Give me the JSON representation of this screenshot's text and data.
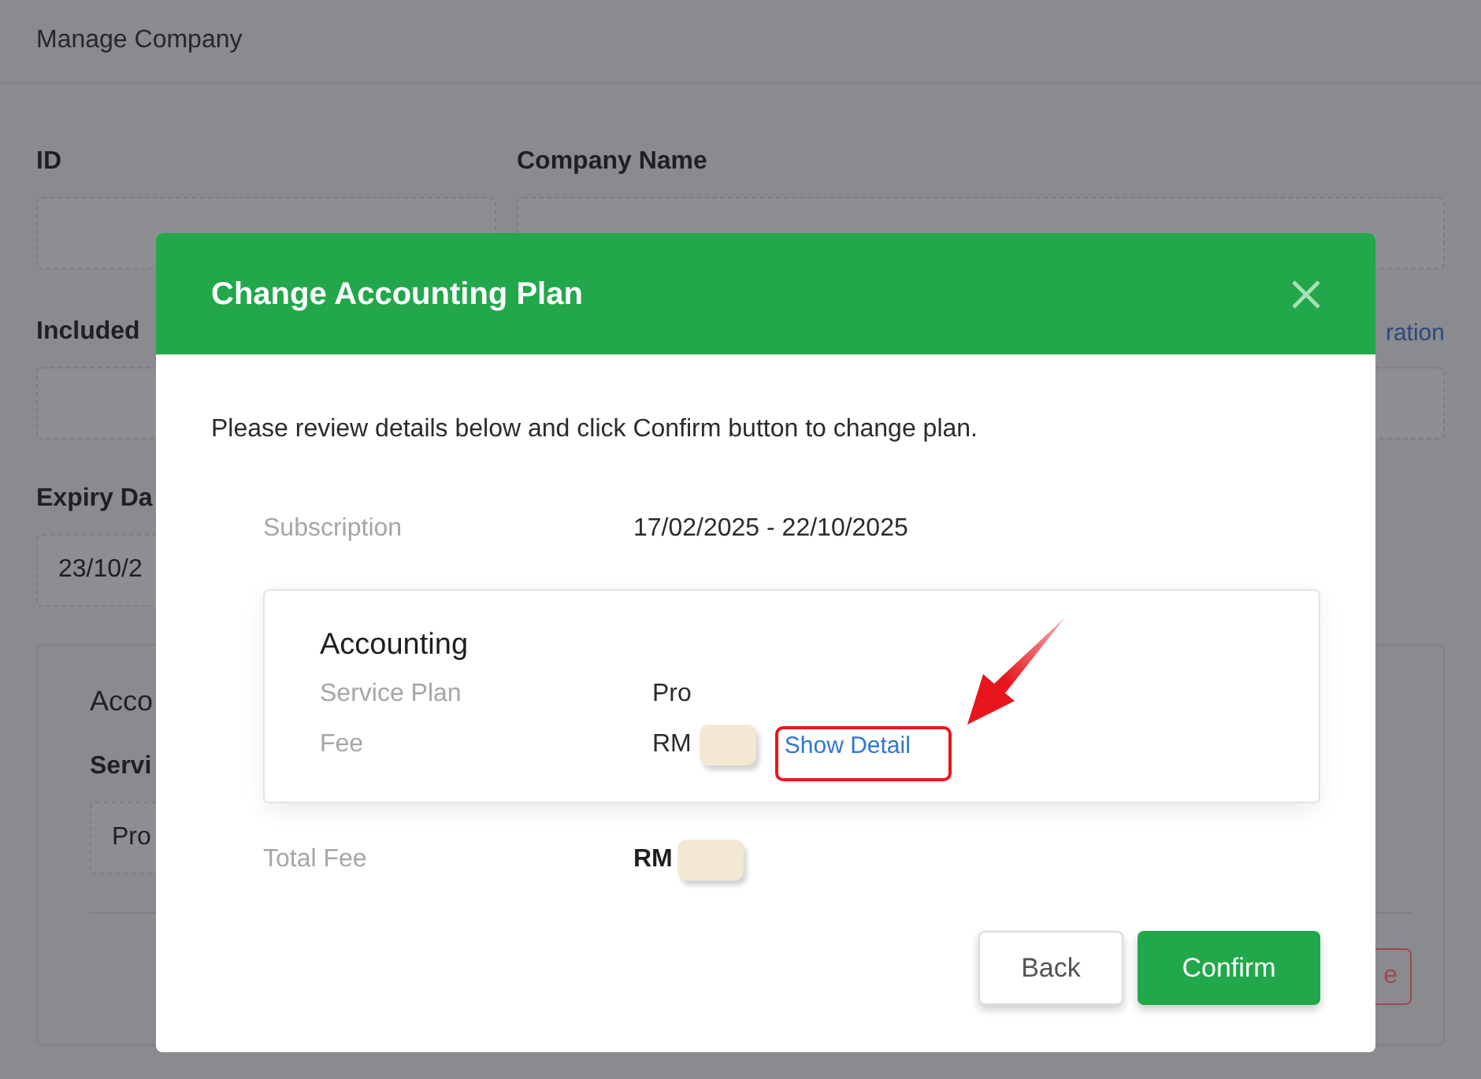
{
  "page": {
    "title": "Manage Company",
    "id_field": {
      "label": "ID"
    },
    "company_field": {
      "label": "Company Name"
    },
    "included_label": "Included",
    "link": "ration",
    "expiry_field": {
      "label": "Expiry Da",
      "value": "23/10/2"
    },
    "section": {
      "title": "Acco",
      "field_label": "Servi",
      "field_value": "Pro",
      "button": "e"
    }
  },
  "dialog": {
    "title": "Change Accounting Plan",
    "intro": "Please review details below and click Confirm button to change plan.",
    "subscription": {
      "label": "Subscription",
      "value": "17/02/2025 - 22/10/2025"
    },
    "plan_card": {
      "title": "Accounting",
      "rows": [
        {
          "kind": "text",
          "label": "Service Plan",
          "value": "Pro"
        },
        {
          "kind": "fee",
          "label": "Fee",
          "value": "RM",
          "link": "Show Detail"
        }
      ]
    },
    "total": {
      "label": "Total Fee",
      "value": "RM"
    },
    "buttons": [
      {
        "kind": "secondary",
        "label": "Back"
      },
      {
        "kind": "primary",
        "label": "Confirm"
      }
    ]
  }
}
